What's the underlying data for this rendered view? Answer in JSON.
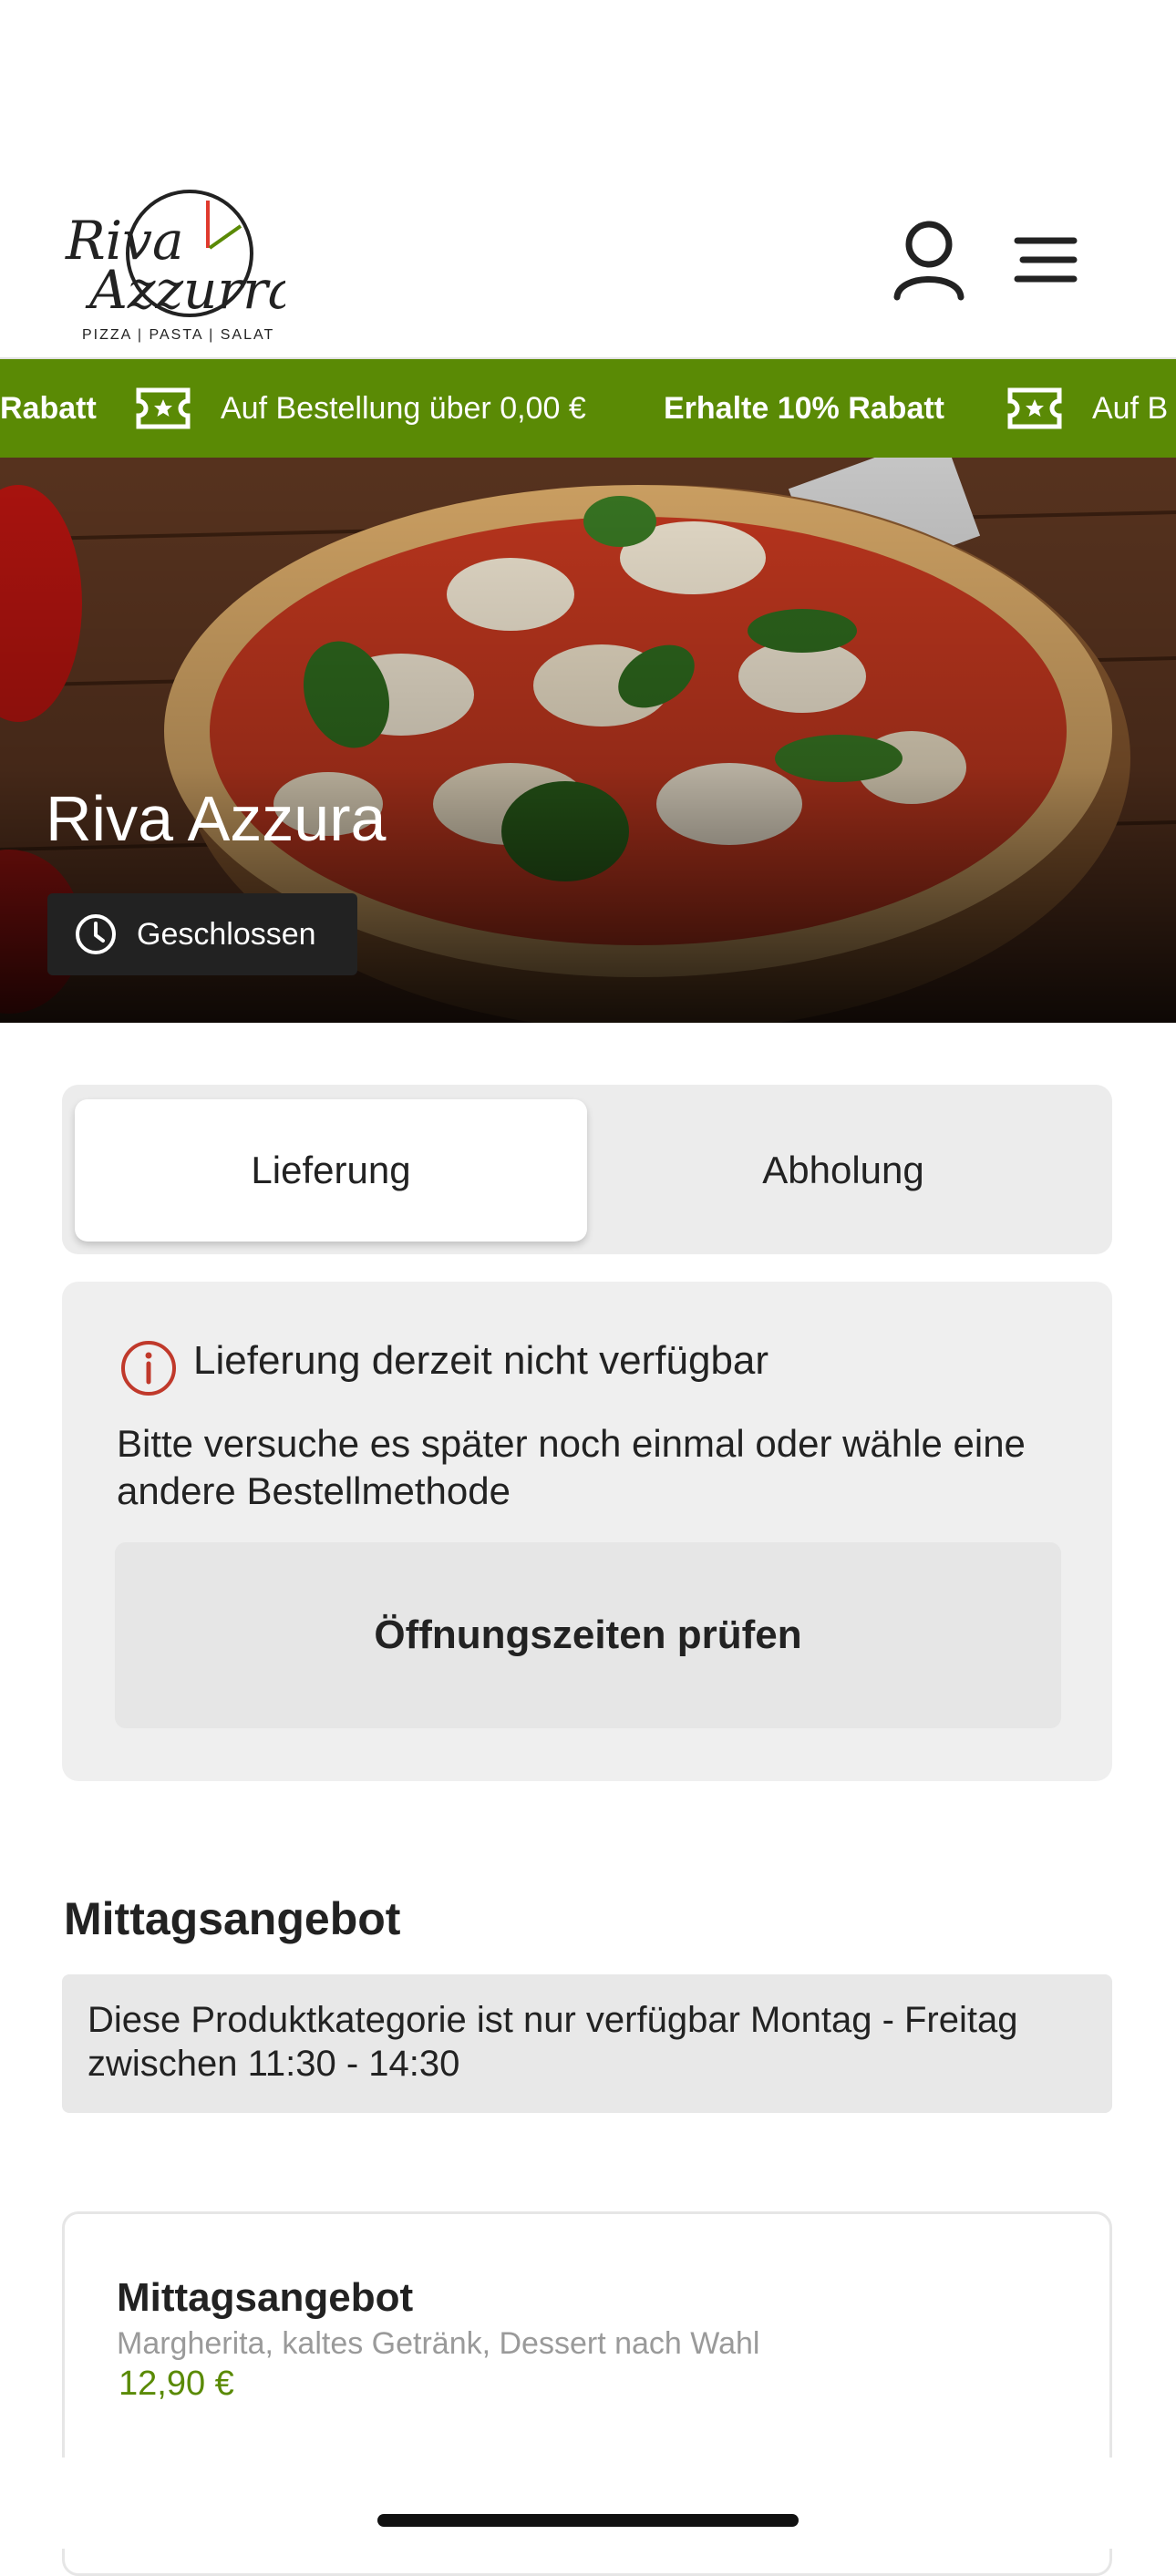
{
  "header": {
    "logo": {
      "line1": "Riva",
      "line2": "Azzurra",
      "tagline": "PIZZA | PASTA | SALAT"
    }
  },
  "promo": {
    "segment1": "Rabatt",
    "segment2": "Auf Bestellung über 0,00 €",
    "segment3": "Erhalte 10% Rabatt",
    "segment4": "Auf B"
  },
  "hero": {
    "title": "Riva Azzura",
    "status": "Geschlossen"
  },
  "mode_toggle": {
    "delivery_label": "Lieferung",
    "pickup_label": "Abholung",
    "selected": "Lieferung"
  },
  "notice": {
    "title": "Lieferung derzeit nicht verfügbar",
    "text": "Bitte versuche es später noch einmal oder wähle eine andere Bestellmethode",
    "button_label": "Öffnungszeiten prüfen"
  },
  "section": {
    "title": "Mittagsangebot",
    "info": "Diese Produktkategorie ist nur verfügbar Montag - Freitag zwischen 11:30 - 14:30"
  },
  "product": {
    "name": "Mittagsangebot",
    "description": "Margherita, kaltes Getränk, Dessert nach Wahl",
    "price": "12,90 €"
  },
  "colors": {
    "brand_green": "#5a8a05",
    "alert_red": "#c0392b"
  }
}
